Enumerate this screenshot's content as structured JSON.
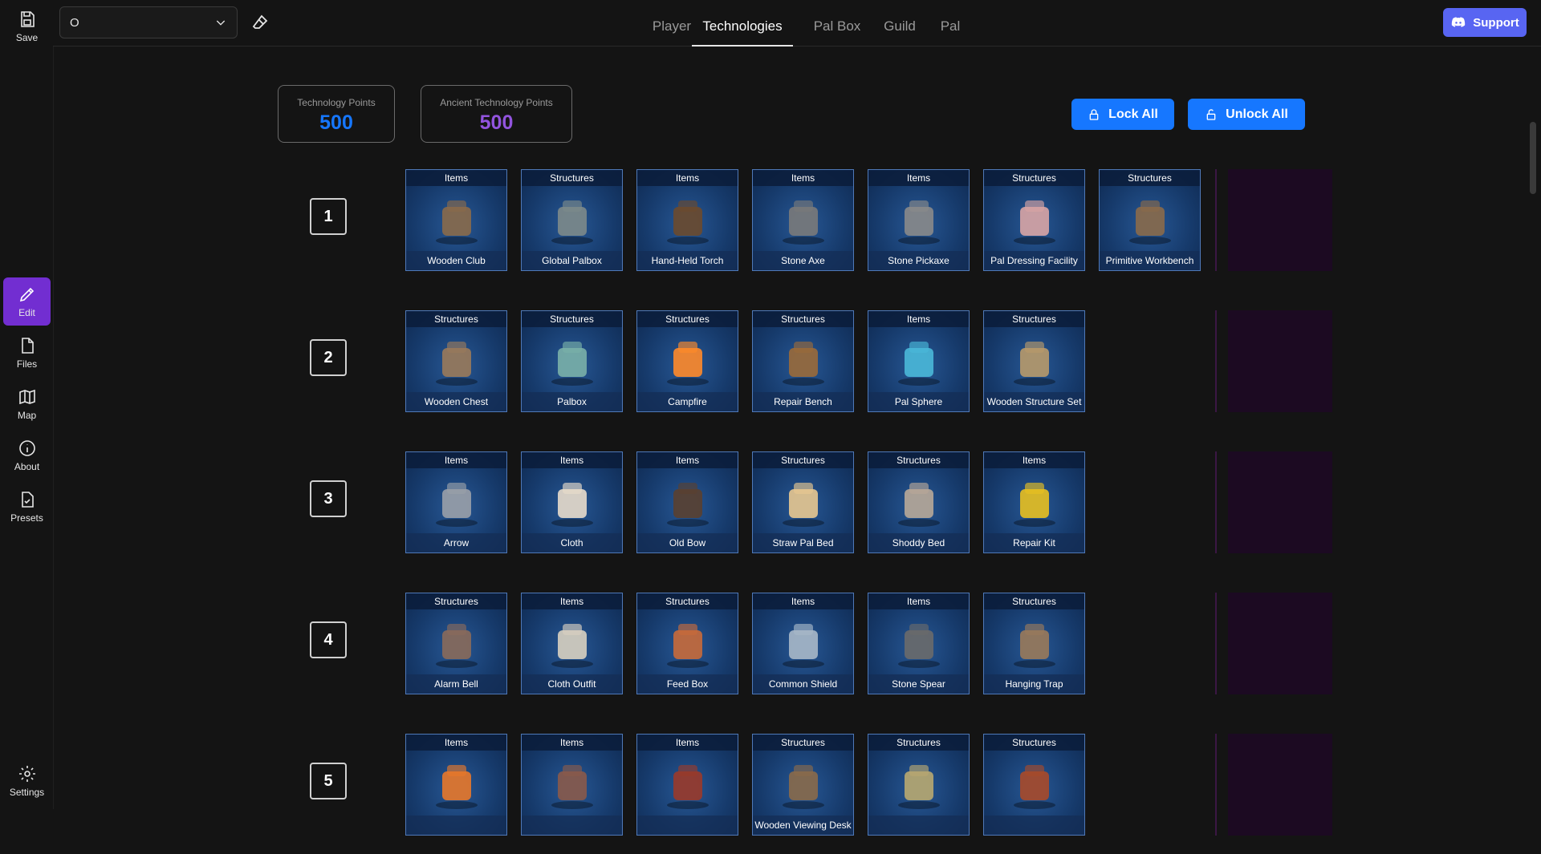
{
  "sidebar": {
    "items": [
      {
        "label": "Save",
        "icon": "save-icon"
      },
      {
        "label": "Edit",
        "icon": "edit-icon",
        "active": true
      },
      {
        "label": "Files",
        "icon": "file-icon"
      },
      {
        "label": "Map",
        "icon": "map-icon"
      },
      {
        "label": "About",
        "icon": "info-icon"
      },
      {
        "label": "Presets",
        "icon": "presets-icon"
      },
      {
        "label": "Settings",
        "icon": "gear-icon"
      }
    ]
  },
  "header": {
    "select_value": "O",
    "tabs": [
      {
        "label": "Player"
      },
      {
        "label": "Technologies",
        "active": true
      },
      {
        "label": "Pal Box"
      },
      {
        "label": "Guild"
      },
      {
        "label": "Pal"
      }
    ],
    "support_label": "Support"
  },
  "points": {
    "tech_label": "Technology Points",
    "tech_value": "500",
    "ancient_label": "Ancient Technology Points",
    "ancient_value": "500"
  },
  "actions": {
    "lock_all": "Lock All",
    "unlock_all": "Unlock All"
  },
  "colors": {
    "accent_purple": "#722ed1",
    "tech_blue": "#1677ff",
    "ancient_purple": "#9254de",
    "discord": "#5865f2"
  },
  "tiers": [
    {
      "level": "1",
      "items": [
        {
          "category": "Items",
          "name": "Wooden Club",
          "icon": "club-icon"
        },
        {
          "category": "Structures",
          "name": "Global Palbox",
          "icon": "global-palbox-icon"
        },
        {
          "category": "Items",
          "name": "Hand-Held Torch",
          "icon": "torch-icon"
        },
        {
          "category": "Items",
          "name": "Stone Axe",
          "icon": "axe-icon"
        },
        {
          "category": "Items",
          "name": "Stone Pickaxe",
          "icon": "pickaxe-icon"
        },
        {
          "category": "Structures",
          "name": "Pal Dressing Facility",
          "icon": "dressing-facility-icon"
        },
        {
          "category": "Structures",
          "name": "Primitive Workbench",
          "icon": "workbench-icon"
        }
      ]
    },
    {
      "level": "2",
      "items": [
        {
          "category": "Structures",
          "name": "Wooden Chest",
          "icon": "chest-icon"
        },
        {
          "category": "Structures",
          "name": "Palbox",
          "icon": "palbox-icon"
        },
        {
          "category": "Structures",
          "name": "Campfire",
          "icon": "campfire-icon"
        },
        {
          "category": "Structures",
          "name": "Repair Bench",
          "icon": "repair-bench-icon"
        },
        {
          "category": "Items",
          "name": "Pal Sphere",
          "icon": "sphere-icon"
        },
        {
          "category": "Structures",
          "name": "Wooden Structure Set",
          "icon": "structure-set-icon"
        }
      ]
    },
    {
      "level": "3",
      "items": [
        {
          "category": "Items",
          "name": "Arrow",
          "icon": "arrow-icon"
        },
        {
          "category": "Items",
          "name": "Cloth",
          "icon": "cloth-icon"
        },
        {
          "category": "Items",
          "name": "Old Bow",
          "icon": "bow-icon"
        },
        {
          "category": "Structures",
          "name": "Straw Pal Bed",
          "icon": "straw-bed-icon"
        },
        {
          "category": "Structures",
          "name": "Shoddy Bed",
          "icon": "bed-icon"
        },
        {
          "category": "Items",
          "name": "Repair Kit",
          "icon": "repair-kit-icon"
        }
      ]
    },
    {
      "level": "4",
      "items": [
        {
          "category": "Structures",
          "name": "Alarm Bell",
          "icon": "alarm-bell-icon"
        },
        {
          "category": "Items",
          "name": "Cloth Outfit",
          "icon": "outfit-icon"
        },
        {
          "category": "Structures",
          "name": "Feed Box",
          "icon": "feed-box-icon"
        },
        {
          "category": "Items",
          "name": "Common Shield",
          "icon": "shield-icon"
        },
        {
          "category": "Items",
          "name": "Stone Spear",
          "icon": "spear-icon"
        },
        {
          "category": "Structures",
          "name": "Hanging Trap",
          "icon": "trap-icon"
        }
      ]
    },
    {
      "level": "5",
      "items": [
        {
          "category": "Items",
          "name": "",
          "icon": "fire-arrow-icon"
        },
        {
          "category": "Items",
          "name": "",
          "icon": "sling-icon"
        },
        {
          "category": "Items",
          "name": "",
          "icon": "fire-bow-icon"
        },
        {
          "category": "Structures",
          "name": "Wooden Viewing Desk",
          "icon": "desk-icon"
        },
        {
          "category": "Structures",
          "name": "",
          "icon": "ring-icon"
        },
        {
          "category": "Structures",
          "name": "",
          "icon": "floor-icon"
        }
      ]
    }
  ]
}
